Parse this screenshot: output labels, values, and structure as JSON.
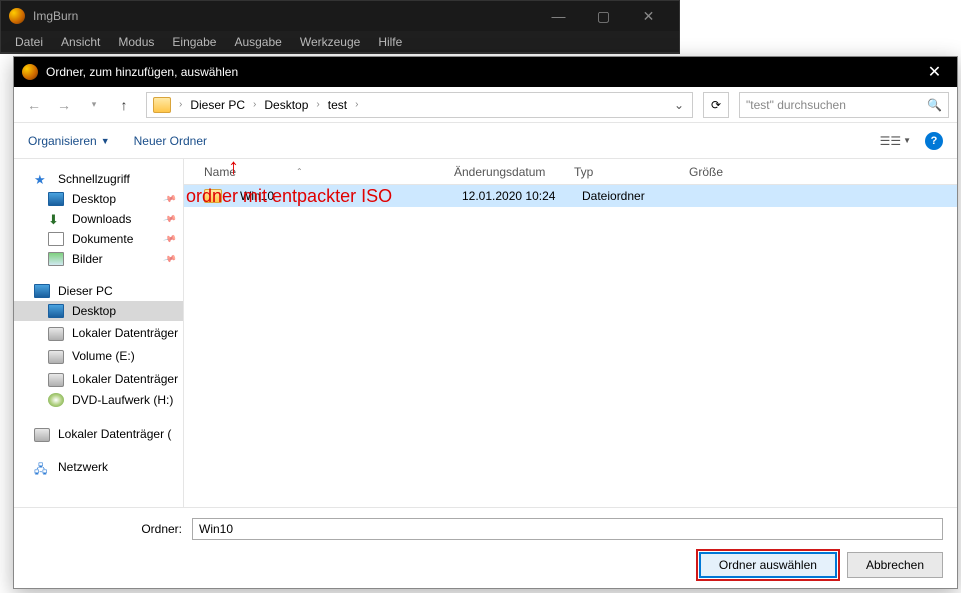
{
  "parent": {
    "title": "ImgBurn",
    "menu": [
      "Datei",
      "Ansicht",
      "Modus",
      "Eingabe",
      "Ausgabe",
      "Werkzeuge",
      "Hilfe"
    ]
  },
  "dialog": {
    "title": "Ordner, zum hinzufügen, auswählen",
    "breadcrumb": {
      "pc": "Dieser PC",
      "desktop": "Desktop",
      "folder": "test"
    },
    "search_placeholder": "\"test\" durchsuchen",
    "toolbar": {
      "organize": "Organisieren",
      "new_folder": "Neuer Ordner"
    },
    "sidebar": {
      "quick": "Schnellzugriff",
      "desktop": "Desktop",
      "downloads": "Downloads",
      "documents": "Dokumente",
      "pictures": "Bilder",
      "this_pc": "Dieser PC",
      "local_disk": "Lokaler Datenträger",
      "volume_e": "Volume (E:)",
      "local_disk2": "Lokaler Datenträger",
      "dvd": "DVD-Laufwerk (H:)",
      "local_disk3": "Lokaler Datenträger (",
      "network": "Netzwerk"
    },
    "columns": {
      "name": "Name",
      "date": "Änderungsdatum",
      "type": "Typ",
      "size": "Größe"
    },
    "rows": [
      {
        "name": "Win10",
        "date": "12.01.2020 10:24",
        "type": "Dateiordner",
        "size": ""
      }
    ],
    "annotation": "ordner mit entpackter ISO",
    "folder_label": "Ordner:",
    "folder_value": "Win10",
    "btn_select": "Ordner auswählen",
    "btn_cancel": "Abbrechen"
  }
}
